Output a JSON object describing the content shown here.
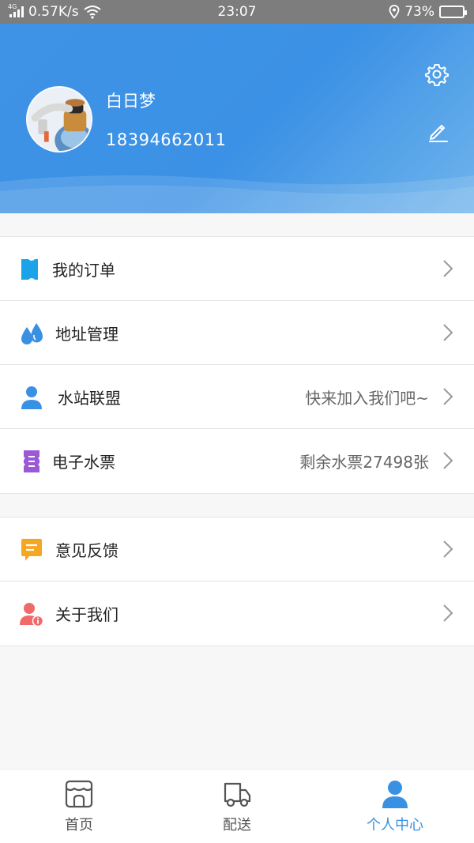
{
  "status_bar": {
    "network_type": "4G",
    "speed": "0.57K/s",
    "time": "23:07",
    "battery": "73%",
    "battery_level": 0.73
  },
  "profile": {
    "name": "白日梦",
    "phone": "18394662011"
  },
  "menu_group_1": [
    {
      "label": "我的订单",
      "value": "",
      "icon": "ticket-icon",
      "color": "#1aa3e8"
    },
    {
      "label": "地址管理",
      "value": "",
      "icon": "droplets-icon",
      "color": "#3a90e3"
    },
    {
      "label": "水站联盟",
      "value": "快来加入我们吧~",
      "icon": "user-icon",
      "color": "#3a90e3"
    },
    {
      "label": "电子水票",
      "value": "剩余水票27498张",
      "icon": "coupon-icon",
      "color": "#9b59d6"
    }
  ],
  "menu_group_2": [
    {
      "label": "意见反馈",
      "value": "",
      "icon": "chat-icon",
      "color": "#f5a623"
    },
    {
      "label": "关于我们",
      "value": "",
      "icon": "user-info-icon",
      "color": "#f06a6a"
    }
  ],
  "tabbar": {
    "items": [
      {
        "label": "首页",
        "icon": "store-icon",
        "active": false
      },
      {
        "label": "配送",
        "icon": "truck-icon",
        "active": false
      },
      {
        "label": "个人中心",
        "icon": "person-icon",
        "active": true
      }
    ],
    "active_color": "#3a90e3"
  },
  "colors": {
    "header_blue": "#3f93e6",
    "background": "#f7f7f7"
  }
}
